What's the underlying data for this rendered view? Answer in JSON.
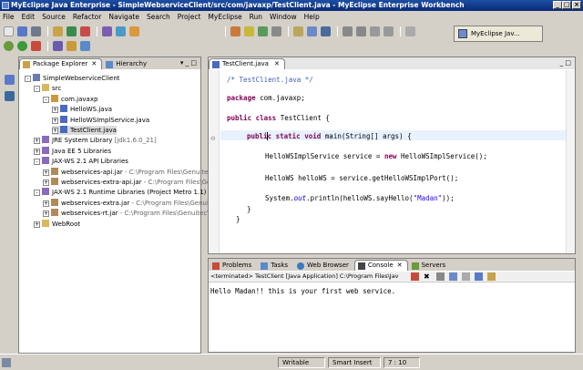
{
  "window": {
    "title": "MyEclipse Java Enterprise - SimpleWebserviceClient/src/com/javaxp/TestClient.java - MyEclipse Enterprise Workbench"
  },
  "menu": [
    "File",
    "Edit",
    "Source",
    "Refactor",
    "Navigate",
    "Search",
    "Project",
    "MyEclipse",
    "Run",
    "Window",
    "Help"
  ],
  "perspective": {
    "label": "MyEclipse Jav..."
  },
  "explorer": {
    "tabs": [
      "Package Explorer",
      "Hierarchy"
    ],
    "tree": [
      {
        "label": "SimpleWebserviceClient",
        "detail": "",
        "indent": 0,
        "exp": "-",
        "icon": "project"
      },
      {
        "label": "src",
        "detail": "",
        "indent": 1,
        "exp": "-",
        "icon": "folder"
      },
      {
        "label": "com.javaxp",
        "detail": "",
        "indent": 2,
        "exp": "-",
        "icon": "package"
      },
      {
        "label": "HelloWS.java",
        "detail": "",
        "indent": 3,
        "exp": "+",
        "icon": "java"
      },
      {
        "label": "HelloWSImplService.java",
        "detail": "",
        "indent": 3,
        "exp": "+",
        "icon": "java"
      },
      {
        "label": "TestClient.java",
        "detail": "",
        "indent": 3,
        "exp": "+",
        "icon": "java",
        "selected": true
      },
      {
        "label": "JRE System Library",
        "detail": " [jdk1.6.0_21]",
        "indent": 1,
        "exp": "+",
        "icon": "lib"
      },
      {
        "label": "Java EE 5 Libraries",
        "detail": "",
        "indent": 1,
        "exp": "+",
        "icon": "lib"
      },
      {
        "label": "JAX-WS 2.1 API Libraries",
        "detail": "",
        "indent": 1,
        "exp": "-",
        "icon": "lib"
      },
      {
        "label": "webservices-api.jar",
        "detail": " - C:\\Program Files\\Genuitec",
        "indent": 2,
        "exp": "+",
        "icon": "jar"
      },
      {
        "label": "webservices-extra-api.jar",
        "detail": " - C:\\Program Files\\Gen",
        "indent": 2,
        "exp": "+",
        "icon": "jar"
      },
      {
        "label": "JAX-WS 2.1 Runtime Libraries (Project Metro 1.1)",
        "detail": "",
        "indent": 1,
        "exp": "-",
        "icon": "lib"
      },
      {
        "label": "webservices-extra.jar",
        "detail": " - C:\\Program Files\\Genui",
        "indent": 2,
        "exp": "+",
        "icon": "jar"
      },
      {
        "label": "webservices-rt.jar",
        "detail": " - C:\\Program Files\\Genuitec\\",
        "indent": 2,
        "exp": "+",
        "icon": "jar"
      },
      {
        "label": "WebRoot",
        "detail": "",
        "indent": 1,
        "exp": "+",
        "icon": "folder"
      }
    ]
  },
  "editor": {
    "tab": "TestClient.java",
    "lines": {
      "l1": "/* TestClient.java */",
      "l2a": "package",
      "l2b": " com.javaxp;",
      "l3a": "public class",
      "l3b": " TestClient {",
      "l4a": "publi",
      "l4b": "c static void",
      "l4c": " main(String[] args) {",
      "l5a": "HelloWSImplService service = ",
      "l5b": "new",
      "l5c": " HelloWSImplService();",
      "l6": "HelloWS helloWS = service.getHelloWSImplPort();",
      "l7a": "System.",
      "l7b": "out",
      "l7c": ".println(helloWS.sayHello(",
      "l7d": "\"Madan\"",
      "l7e": "));",
      "l8": "}",
      "l9": "}"
    }
  },
  "console": {
    "tabs": [
      "Problems",
      "Tasks",
      "Web Browser",
      "Console",
      "Servers"
    ],
    "header": "<terminated> TestClient [Java Application] C:\\Program Files\\Jav",
    "output": "Hello Madan!! this is your first web service."
  },
  "status": {
    "writable": "Writable",
    "insert": "Smart Insert",
    "position": "7 : 10"
  },
  "colors": {
    "titlebar": "#0a2a78",
    "keyword": "#7f0055",
    "comment": "#3f5fbf",
    "string": "#2a00ff"
  }
}
